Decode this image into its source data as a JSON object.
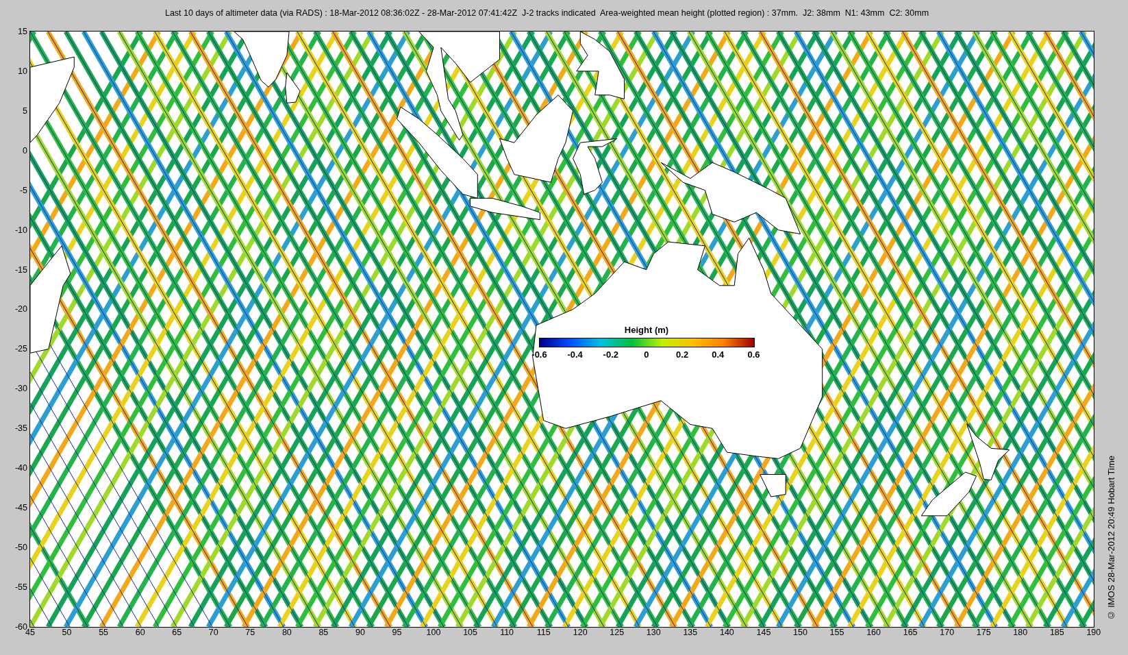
{
  "title": "Last 10 days of altimeter data (via RADS) : 18-Mar-2012 08:36:02Z - 28-Mar-2012 07:41:42Z  J-2 tracks indicated  Area-weighted mean height (plotted region) : 37mm.  J2: 38mm  N1: 43mm  C2: 30mm",
  "y_ticks": [
    "15",
    "10",
    "5",
    "0",
    "-5",
    "-10",
    "-15",
    "-20",
    "-25",
    "-30",
    "-35",
    "-40",
    "-45",
    "-50",
    "-55",
    "-60"
  ],
  "x_ticks": [
    "45",
    "50",
    "55",
    "60",
    "65",
    "70",
    "75",
    "80",
    "85",
    "90",
    "95",
    "100",
    "105",
    "110",
    "115",
    "120",
    "125",
    "130",
    "135",
    "140",
    "145",
    "150",
    "155",
    "160",
    "165",
    "170",
    "175",
    "180",
    "185",
    "190"
  ],
  "colorbar": {
    "title": "Height (m)",
    "ticks": [
      "-0.6",
      "-0.4",
      "-0.2",
      "0",
      "0.2",
      "0.4",
      "0.6"
    ]
  },
  "credit": "© IMOS 28-Mar-2012 20:49 Hobart Time"
}
